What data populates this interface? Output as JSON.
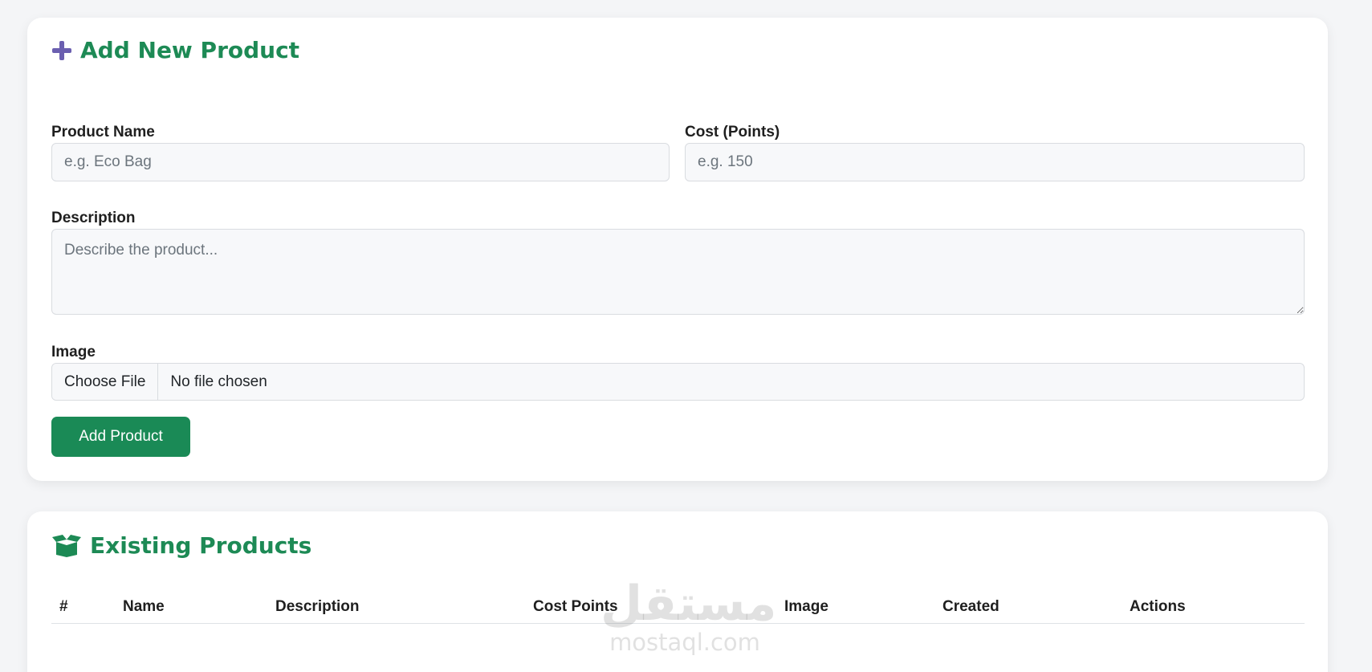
{
  "add_form": {
    "title": "Add New Product",
    "title_icon": "plus-icon",
    "fields": {
      "name": {
        "label": "Product Name",
        "placeholder": "e.g. Eco Bag"
      },
      "cost": {
        "label": "Cost (Points)",
        "placeholder": "e.g. 150"
      },
      "description": {
        "label": "Description",
        "placeholder": "Describe the product..."
      },
      "image": {
        "label": "Image",
        "button": "Choose File",
        "status": "No file chosen"
      }
    },
    "submit_label": "Add Product"
  },
  "products": {
    "title": "Existing Products",
    "title_icon": "box-open-icon",
    "columns": [
      "#",
      "Name",
      "Description",
      "Cost Points",
      "Image",
      "Created",
      "Actions"
    ]
  },
  "watermark": {
    "arabic": "مستقل",
    "latin": "mostaql.com"
  },
  "colors": {
    "accent_green": "#1d8a55",
    "button_green": "#1a8a56",
    "plus_icon_purple": "#6b5fb0",
    "page_background": "#f4f5f7"
  }
}
